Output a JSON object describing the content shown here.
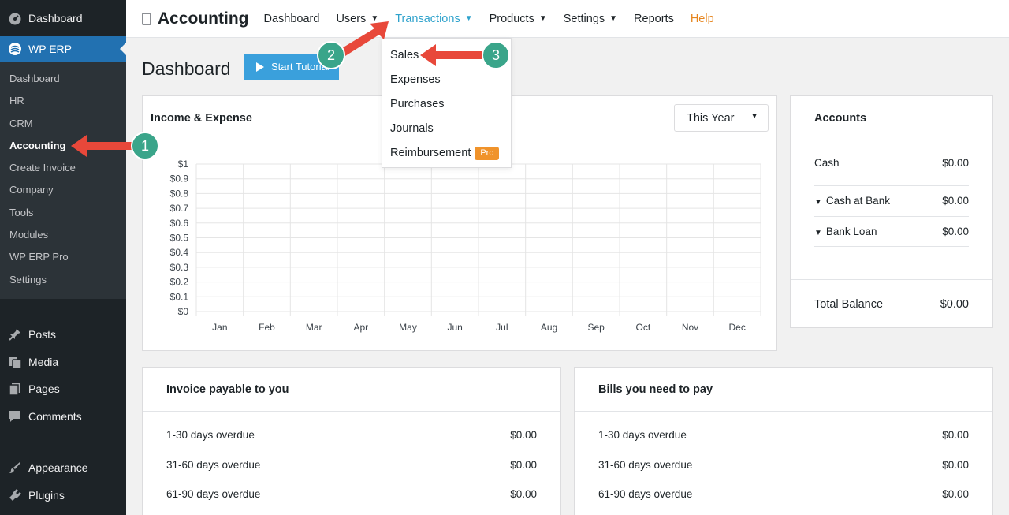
{
  "sidebar": {
    "dashboard_label": "Dashboard",
    "wperp_label": "WP ERP",
    "submenu": [
      "Dashboard",
      "HR",
      "CRM",
      "Accounting",
      "Create Invoice",
      "Company",
      "Tools",
      "Modules",
      "WP ERP Pro",
      "Settings"
    ],
    "current_submenu": "Accounting",
    "items": [
      {
        "label": "Posts",
        "icon": "pin-icon"
      },
      {
        "label": "Media",
        "icon": "media-icon"
      },
      {
        "label": "Pages",
        "icon": "pages-icon"
      },
      {
        "label": "Comments",
        "icon": "comments-icon"
      },
      {
        "label": "Appearance",
        "icon": "brush-icon"
      },
      {
        "label": "Plugins",
        "icon": "plugin-icon"
      }
    ]
  },
  "topbar": {
    "brand": "Accounting",
    "nav": [
      {
        "label": "Dashboard",
        "dropdown": false
      },
      {
        "label": "Users",
        "dropdown": true
      },
      {
        "label": "Transactions",
        "dropdown": true,
        "active": true
      },
      {
        "label": "Products",
        "dropdown": true
      },
      {
        "label": "Settings",
        "dropdown": true
      },
      {
        "label": "Reports",
        "dropdown": false
      },
      {
        "label": "Help",
        "dropdown": false
      }
    ]
  },
  "transactions_menu": {
    "items": [
      "Sales",
      "Expenses",
      "Purchases",
      "Journals",
      "Reimbursement"
    ],
    "pro_badge": "Pro"
  },
  "page": {
    "title": "Dashboard",
    "tutorial_button": "Start Tutorial"
  },
  "income_expense": {
    "title": "Income & Expense",
    "period": "This Year"
  },
  "chart_data": {
    "type": "line",
    "categories": [
      "Jan",
      "Feb",
      "Mar",
      "Apr",
      "May",
      "Jun",
      "Jul",
      "Aug",
      "Sep",
      "Oct",
      "Nov",
      "Dec"
    ],
    "y_ticks": [
      "$1",
      "$0.9",
      "$0.8",
      "$0.7",
      "$0.6",
      "$0.5",
      "$0.4",
      "$0.3",
      "$0.2",
      "$0.1",
      "$0"
    ],
    "ylim": [
      0,
      1
    ],
    "series": [],
    "grid": true
  },
  "accounts": {
    "title": "Accounts",
    "rows": [
      {
        "label": "Cash",
        "value": "$0.00",
        "expandable": false
      },
      {
        "label": "Cash at Bank",
        "value": "$0.00",
        "expandable": true
      },
      {
        "label": "Bank Loan",
        "value": "$0.00",
        "expandable": true
      }
    ],
    "total_label": "Total Balance",
    "total_value": "$0.00"
  },
  "invoice_payable": {
    "title": "Invoice payable to you",
    "rows": [
      {
        "label": "1-30 days overdue",
        "value": "$0.00"
      },
      {
        "label": "31-60 days overdue",
        "value": "$0.00"
      },
      {
        "label": "61-90 days overdue",
        "value": "$0.00"
      }
    ]
  },
  "bills_to_pay": {
    "title": "Bills you need to pay",
    "rows": [
      {
        "label": "1-30 days overdue",
        "value": "$0.00"
      },
      {
        "label": "31-60 days overdue",
        "value": "$0.00"
      },
      {
        "label": "61-90 days overdue",
        "value": "$0.00"
      }
    ]
  },
  "annotations": [
    "1",
    "2",
    "3"
  ],
  "colors": {
    "sidebar_bg": "#1d2327",
    "submenu_bg": "#2c3338",
    "active_blue": "#2271b1",
    "link_blue": "#2ea2cc",
    "help_orange": "#e6851e",
    "pro_orange": "#f0932b",
    "annotation_red": "#e8483a",
    "annotation_green": "#3aa58a"
  }
}
